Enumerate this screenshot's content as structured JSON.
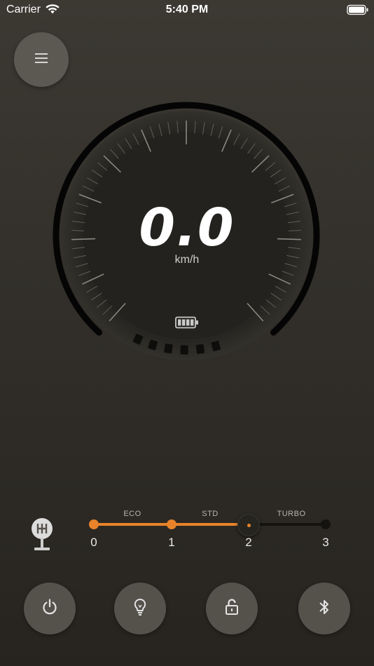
{
  "status_bar": {
    "carrier": "Carrier",
    "time": "5:40 PM"
  },
  "speedometer": {
    "speed": "0.0",
    "unit": "km/h"
  },
  "assist_mode": {
    "modes": [
      "ECO",
      "STD",
      "TURBO"
    ],
    "levels": [
      "0",
      "1",
      "2",
      "3"
    ],
    "selected_level": 2
  },
  "buttons": [
    "menu-icon",
    "power-icon",
    "lightbulb-icon",
    "unlock-icon",
    "bluetooth-icon"
  ],
  "colors": {
    "accent": "#e8832a",
    "track_inactive": "#141310",
    "button_bg": "#55524c"
  }
}
